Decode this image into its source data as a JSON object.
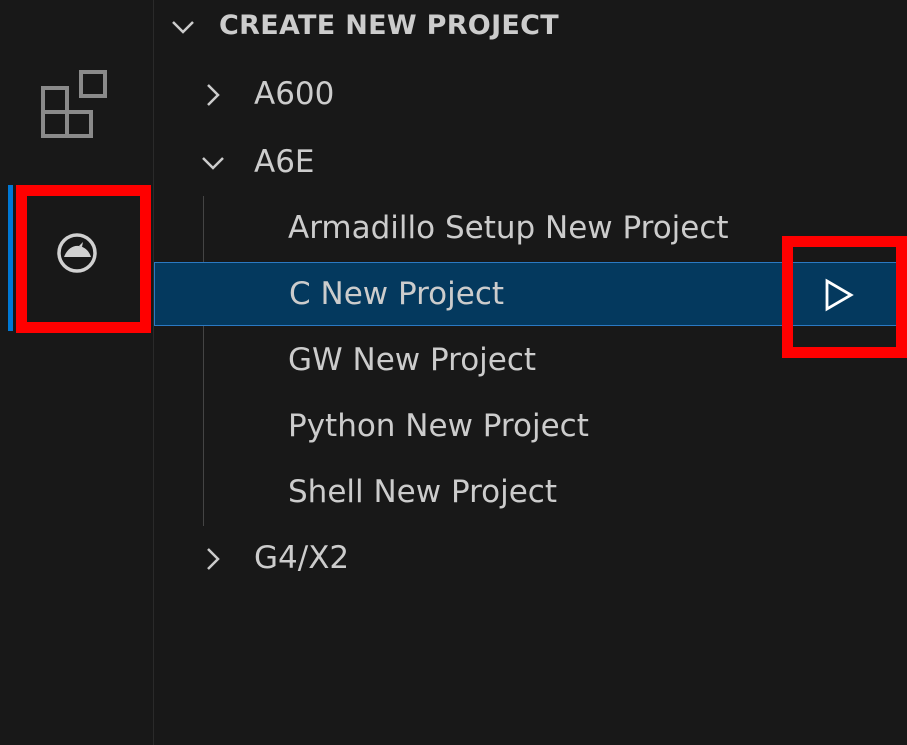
{
  "activity_bar": {
    "items": [
      {
        "icon": "extensions-icon",
        "active": false
      },
      {
        "icon": "armadillo-icon",
        "active": true
      }
    ],
    "accent_color": "#0078d4"
  },
  "explorer": {
    "section_title": "CREATE NEW PROJECT",
    "tree": [
      {
        "label": "A600",
        "expanded": false,
        "children": []
      },
      {
        "label": "A6E",
        "expanded": true,
        "children": [
          {
            "label": "Armadillo Setup New Project"
          },
          {
            "label": "C New Project",
            "selected": true,
            "action_icon": "run-icon"
          },
          {
            "label": "GW New Project"
          },
          {
            "label": "Python New Project"
          },
          {
            "label": "Shell New Project"
          }
        ]
      },
      {
        "label": "G4/X2",
        "expanded": false,
        "children": []
      }
    ]
  },
  "highlight_color": "#ff0000",
  "selection_color": "#04395e"
}
